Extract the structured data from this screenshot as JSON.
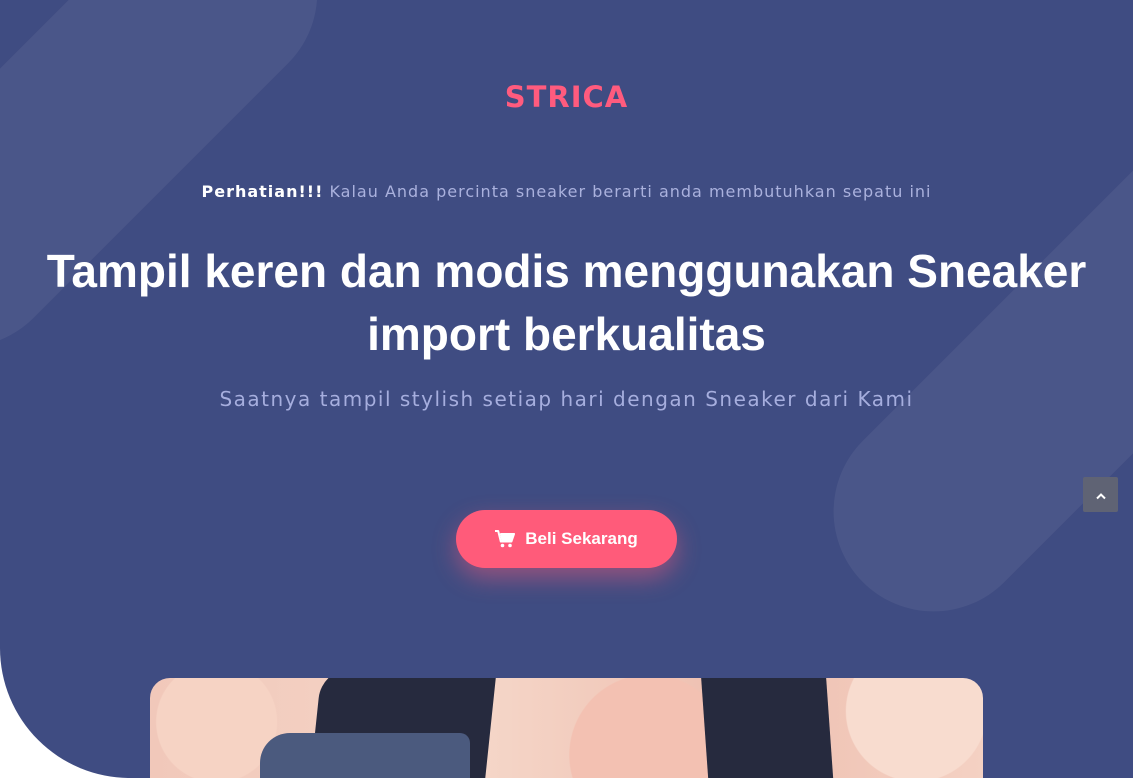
{
  "brand": "STRICA",
  "notice": {
    "strong": "Perhatian!!!",
    "text": " Kalau Anda percinta sneaker berarti anda membutuhkan sepatu ini"
  },
  "headline": "Tampil keren dan modis menggunakan Sneaker import berkualitas",
  "subheadline": "Saatnya tampil stylish setiap hari dengan Sneaker dari Kami",
  "cta": {
    "label": "Beli Sekarang",
    "icon": "shopping-cart-icon"
  },
  "scroll_top": {
    "icon": "chevron-up-icon"
  },
  "colors": {
    "background": "#3f4c82",
    "accent": "#ff5b7a",
    "muted_text": "#a6aede"
  }
}
